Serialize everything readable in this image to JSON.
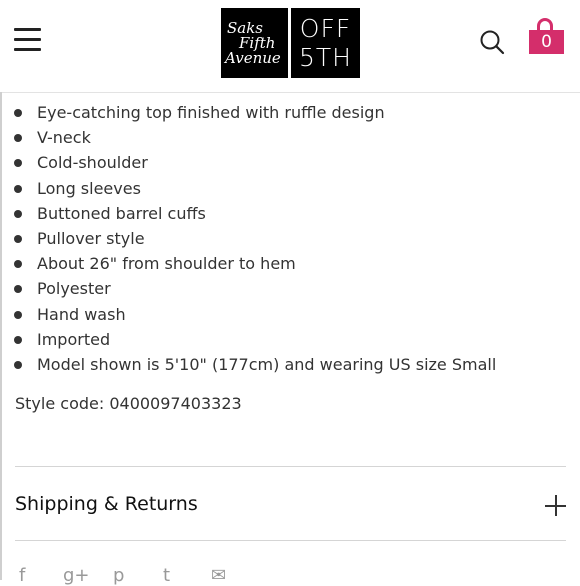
{
  "header": {
    "logo": {
      "saks_line1": "Saks",
      "saks_line2": "Fifth",
      "saks_line3": "Avenue",
      "off_line1": "OFF",
      "off_line2": "5TH"
    },
    "bag_count": "0",
    "icons": [
      "menu-icon",
      "search-icon",
      "shopping-bag-icon"
    ],
    "accent_color": "#d42e6b"
  },
  "details": {
    "features": [
      "Eye-catching top finished with ruffle design",
      "V-neck",
      "Cold-shoulder",
      "Long sleeves",
      "Buttoned barrel cuffs",
      "Pullover style",
      "About 26\" from shoulder to hem",
      "Polyester",
      "Hand wash",
      "Imported",
      "Model shown is 5'10\" (177cm) and wearing US size Small"
    ],
    "style_code": "Style code: 0400097403323"
  },
  "shipping": {
    "title": "Shipping & Returns",
    "icon": "plus-icon"
  },
  "social": {
    "icons": [
      "facebook-icon",
      "google-plus-icon",
      "pinterest-icon",
      "twitter-icon",
      "email-icon"
    ],
    "glyphs": [
      "f",
      "g+",
      "p",
      "t",
      "✉"
    ]
  }
}
